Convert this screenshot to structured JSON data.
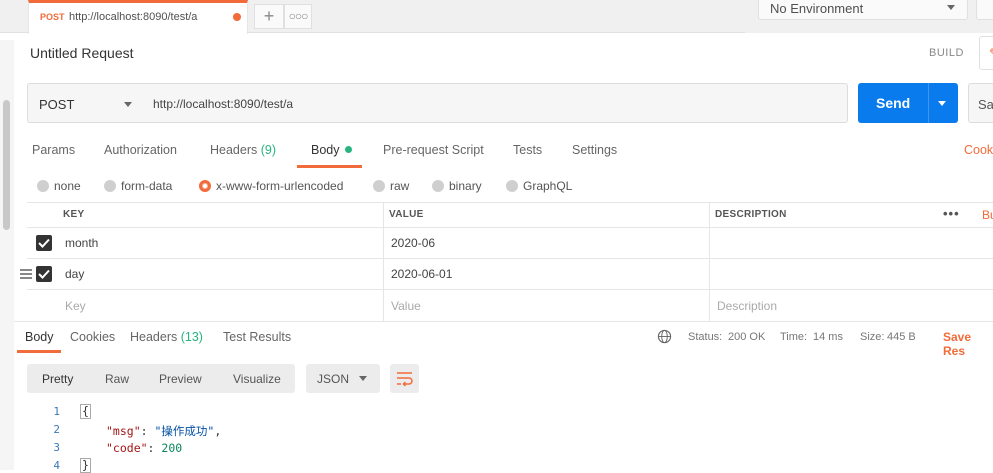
{
  "tab": {
    "method": "POST",
    "url": "http://localhost:8090/test/a"
  },
  "environment": {
    "selected": "No Environment"
  },
  "request": {
    "title": "Untitled Request",
    "build_label": "BUILD",
    "method": "POST",
    "url": "http://localhost:8090/test/a",
    "send_label": "Send",
    "save_label": "Sa"
  },
  "request_tabs": {
    "params": "Params",
    "authorization": "Authorization",
    "headers": "Headers",
    "headers_count": "(9)",
    "body": "Body",
    "prerequest": "Pre-request Script",
    "tests": "Tests",
    "settings": "Settings",
    "cookies": "Cook"
  },
  "body_types": {
    "none": "none",
    "form_data": "form-data",
    "urlencoded": "x-www-form-urlencoded",
    "raw": "raw",
    "binary": "binary",
    "graphql": "GraphQL",
    "selected": "x-www-form-urlencoded"
  },
  "kv_table": {
    "headers": {
      "key": "KEY",
      "value": "VALUE",
      "description": "DESCRIPTION",
      "bulk": "Bu"
    },
    "rows": [
      {
        "key": "month",
        "value": "2020-06",
        "checked": true
      },
      {
        "key": "day",
        "value": "2020-06-01",
        "checked": true
      }
    ],
    "placeholders": {
      "key": "Key",
      "value": "Value",
      "description": "Description"
    }
  },
  "response_tabs": {
    "body": "Body",
    "cookies": "Cookies",
    "headers": "Headers",
    "headers_count": "(13)",
    "test_results": "Test Results"
  },
  "response_status": {
    "status_label": "Status:",
    "status": "200 OK",
    "time_label": "Time:",
    "time": "14 ms",
    "size_label": "Size:",
    "size": "445 B",
    "save_response": "Save Res"
  },
  "format": {
    "pretty": "Pretty",
    "raw": "Raw",
    "preview": "Preview",
    "visualize": "Visualize",
    "json": "JSON"
  },
  "code": {
    "line_numbers": [
      "1",
      "2",
      "3",
      "4"
    ],
    "open_brace": "{",
    "close_brace": "}",
    "msg_key": "\"msg\"",
    "msg_value": "\"操作成功\"",
    "code_key": "\"code\"",
    "code_value": "200",
    "colon": ": ",
    "comma": ","
  },
  "colors": {
    "accent": "#f26b3a",
    "send": "#097bed",
    "success": "#26b47f"
  }
}
